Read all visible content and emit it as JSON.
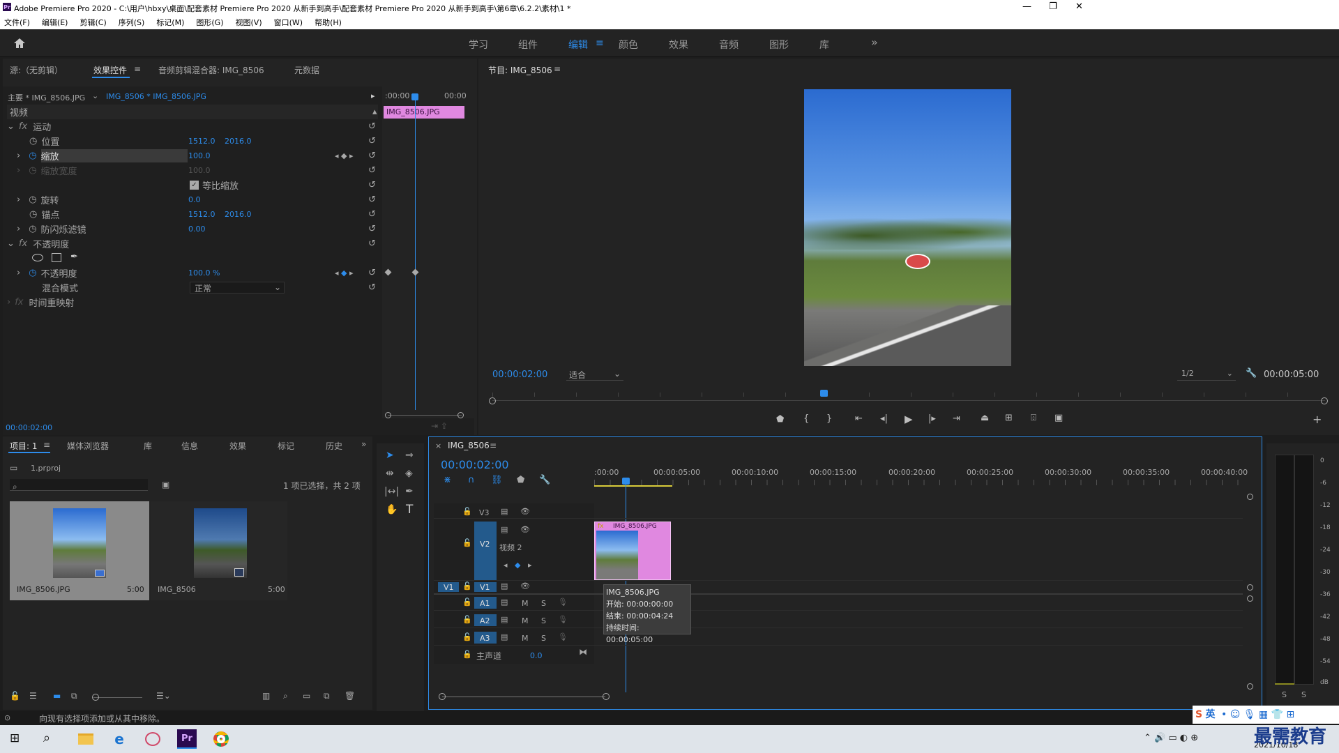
{
  "title_bar": {
    "title": "Adobe Premiere Pro 2020 - C:\\用户\\hbxy\\桌面\\配套素材 Premiere Pro 2020 从新手到高手\\配套素材 Premiere Pro 2020 从新手到高手\\第6章\\6.2.2\\素材\\1 *",
    "minimize": "—",
    "maximize": "❐",
    "close": "✕"
  },
  "menu": [
    "文件(F)",
    "编辑(E)",
    "剪辑(C)",
    "序列(S)",
    "标记(M)",
    "图形(G)",
    "视图(V)",
    "窗口(W)",
    "帮助(H)"
  ],
  "workspaces": [
    "学习",
    "组件",
    "编辑",
    "颜色",
    "效果",
    "音频",
    "图形",
    "库"
  ],
  "workspace_more": "»",
  "source_tabs": [
    "源:（无剪辑）",
    "效果控件",
    "音频剪辑混合器: IMG_8506",
    "元数据"
  ],
  "ec": {
    "master": "主要 * IMG_8506.JPG",
    "clip": "IMG_8506 * IMG_8506.JPG",
    "t_start": ":00:00",
    "t_end": "00:00",
    "clip_bar": "IMG_8506.JPG",
    "video": "视频",
    "motion": "运动",
    "position": {
      "label": "位置",
      "x": "1512.0",
      "y": "2016.0"
    },
    "scale": {
      "label": "缩放",
      "value": "100.0"
    },
    "scale_width": {
      "label": "缩放宽度",
      "value": "100.0"
    },
    "uniform": "等比缩放",
    "rotation": {
      "label": "旋转",
      "value": "0.0"
    },
    "anchor": {
      "label": "锚点",
      "x": "1512.0",
      "y": "2016.0"
    },
    "flicker": {
      "label": "防闪烁滤镜",
      "value": "0.00"
    },
    "opacity_group": "不透明度",
    "opacity": {
      "label": "不透明度",
      "value": "100.0 %"
    },
    "blend": {
      "label": "混合模式",
      "value": "正常"
    },
    "time_remap": "时间重映射",
    "timecode": "00:00:02:00"
  },
  "program": {
    "title": "节目: IMG_8506",
    "timecode": "00:00:02:00",
    "fit": "适合",
    "res": "1/2",
    "duration": "00:00:05:00"
  },
  "project": {
    "tabs": [
      "项目: 1",
      "媒体浏览器",
      "库",
      "信息",
      "效果",
      "标记",
      "历史"
    ],
    "file": "1.prproj",
    "status": "1 项已选择，共 2 项",
    "items": [
      {
        "name": "IMG_8506.JPG",
        "dur": "5:00"
      },
      {
        "name": "IMG_8506",
        "dur": "5:00"
      }
    ]
  },
  "timeline": {
    "title": "IMG_8506",
    "timecode": "00:00:02:00",
    "ruler": [
      ":00:00",
      "00:00:05:00",
      "00:00:10:00",
      "00:00:15:00",
      "00:00:20:00",
      "00:00:25:00",
      "00:00:30:00",
      "00:00:35:00",
      "00:00:40:00"
    ],
    "tracks": {
      "v3": "V3",
      "v2": "V2",
      "v2name": "视频 2",
      "v1": "V1",
      "a1": "A1",
      "a2": "A2",
      "a3": "A3",
      "master": "主声道",
      "master_val": "0.0"
    },
    "clip": "IMG_8506.JPG",
    "tooltip": [
      "IMG_8506.JPG",
      "开始: 00:00:00:00",
      "结束: 00:00:04:24",
      "持续时间: 00:00:05:00"
    ]
  },
  "meter": {
    "scale": [
      "0",
      "-6",
      "-12",
      "-18",
      "-24",
      "-30",
      "-36",
      "-42",
      "-48",
      "-54",
      "dB"
    ],
    "solo": [
      "S",
      "S"
    ]
  },
  "status_bar": "向现有选择项添加或从其中移除。",
  "taskbar": {
    "ime": "英",
    "date": "2021/10/18",
    "watermark": "最需教育"
  }
}
